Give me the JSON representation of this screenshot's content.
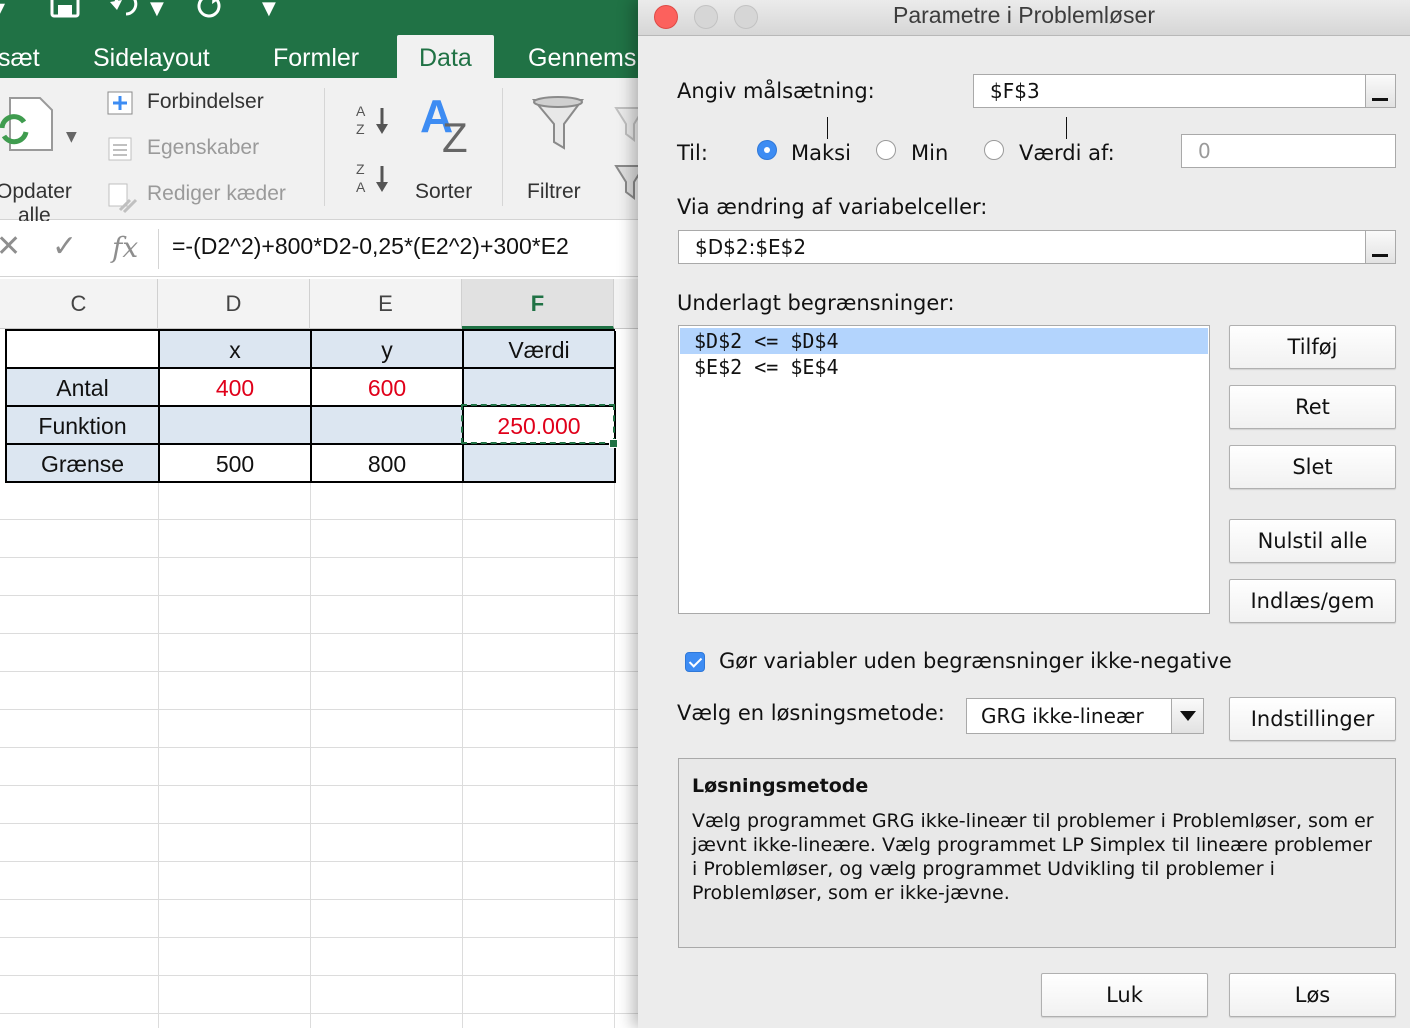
{
  "excel": {
    "tabs": [
      "sæt",
      "Sidelayout",
      "Formler",
      "Data",
      "Gennems"
    ],
    "active_tab": "Data",
    "ribbon": {
      "refresh_line1": "Opdater",
      "refresh_line2": "alle",
      "connections": "Forbindelser",
      "properties": "Egenskaber",
      "edit_links": "Rediger kæder",
      "sort": "Sorter",
      "filter": "Filtrer"
    },
    "formula_bar": {
      "cancel_icon": "✕",
      "enter_icon": "✓",
      "fx_label": "fx",
      "formula": "=-(D2^2)+800*D2-0,25*(E2^2)+300*E2"
    },
    "columns": [
      "C",
      "D",
      "E",
      "F"
    ],
    "active_column": "F",
    "table": {
      "header": [
        "",
        "x",
        "y",
        "Værdi"
      ],
      "rows": [
        [
          "Antal",
          "400",
          "600",
          ""
        ],
        [
          "Funktion",
          "",
          "",
          "250.000"
        ],
        [
          "Grænse",
          "500",
          "800",
          ""
        ]
      ]
    },
    "colors": {
      "brand": "#207245",
      "header_fill": "#dce6f1",
      "value_red": "#e0001a"
    }
  },
  "dialog": {
    "title": "Parametre i Problemløser",
    "objective_label": "Angiv målsætning:",
    "objective_value": "$F$3",
    "to_label": "Til:",
    "radio_max": "Maksi",
    "radio_min": "Min",
    "radio_value": "Værdi af:",
    "value_of": "0",
    "selected_radio": "Maksi",
    "changing_label": "Via ændring af variabelceller:",
    "changing_value": "$D$2:$E$2",
    "constraints_label": "Underlagt begrænsninger:",
    "constraints": [
      "$D$2 <= $D$4",
      "$E$2 <= $E$4"
    ],
    "selected_constraint": 0,
    "btn_add": "Tilføj",
    "btn_change": "Ret",
    "btn_delete": "Slet",
    "btn_reset": "Nulstil alle",
    "btn_load_save": "Indlæs/gem",
    "nonneg_label": "Gør variabler uden begrænsninger ikke-negative",
    "nonneg_checked": true,
    "method_label": "Vælg en løsningsmetode:",
    "method_value": "GRG ikke-lineær",
    "btn_options": "Indstillinger",
    "method_box_title": "Løsningsmetode",
    "method_box_text": "Vælg programmet GRG ikke-lineær til problemer i Problemløser, som er jævnt ikke-lineære. Vælg programmet LP Simplex til lineære problemer i Problemløser, og vælg programmet Udvikling til problemer i Problemløser, som er ikke-jævne.",
    "btn_close": "Luk",
    "btn_solve": "Løs",
    "colors": {
      "accent": "#3d8cf3",
      "close": "#fc615d",
      "inactive": "#d0d0d0"
    }
  }
}
